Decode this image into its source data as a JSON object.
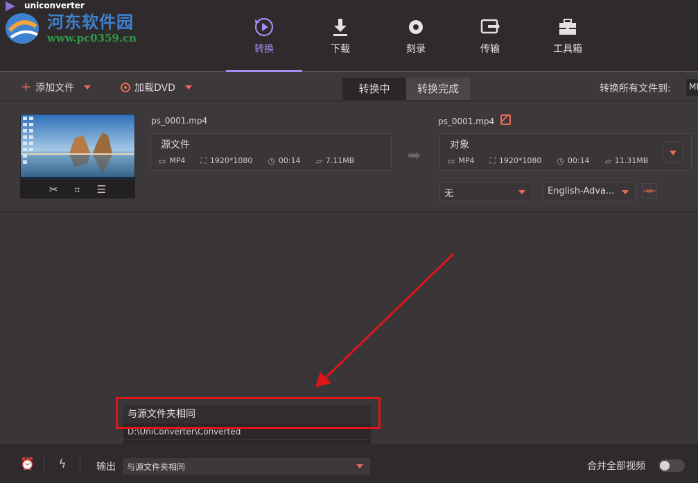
{
  "app": {
    "title": "uniconverter"
  },
  "watermark": {
    "name": "河东软件园",
    "url": "www.pc0359.cn"
  },
  "nav": [
    {
      "label": "转换",
      "icon": "convert-icon",
      "active": true
    },
    {
      "label": "下载",
      "icon": "download-icon"
    },
    {
      "label": "刻录",
      "icon": "burn-icon"
    },
    {
      "label": "传输",
      "icon": "transfer-icon"
    },
    {
      "label": "工具箱",
      "icon": "toolbox-icon"
    }
  ],
  "toolbar": {
    "add_file": "添加文件",
    "load_dvd": "加载DVD",
    "tab_converting": "转换中",
    "tab_done": "转换完成",
    "convert_all_to": "转换所有文件到:",
    "convert_all_format": "MI"
  },
  "file": {
    "source_name": "ps_0001.mp4",
    "source_label": "源文件",
    "source_format": "MP4",
    "source_resolution": "1920*1080",
    "source_duration": "00:14",
    "source_size": "7.11MB",
    "target_name": "ps_0001.mp4",
    "target_label": "对象",
    "target_format": "MP4",
    "target_resolution": "1920*1080",
    "target_duration": "00:14",
    "target_size": "11.31MB",
    "subtitle": "无",
    "audio_track": "English-Adva..."
  },
  "output_dropdown": {
    "options": [
      "与源文件夹相同",
      "D:\\UniConverter\\Converted",
      "..."
    ]
  },
  "bottom": {
    "output_label": "输出",
    "output_value": "与源文件夹相同",
    "merge_label": "合并全部视频",
    "merge_enabled": false
  },
  "colors": {
    "accent": "#a98df0",
    "orange": "#e96a57",
    "highlight": "#e0151b"
  }
}
